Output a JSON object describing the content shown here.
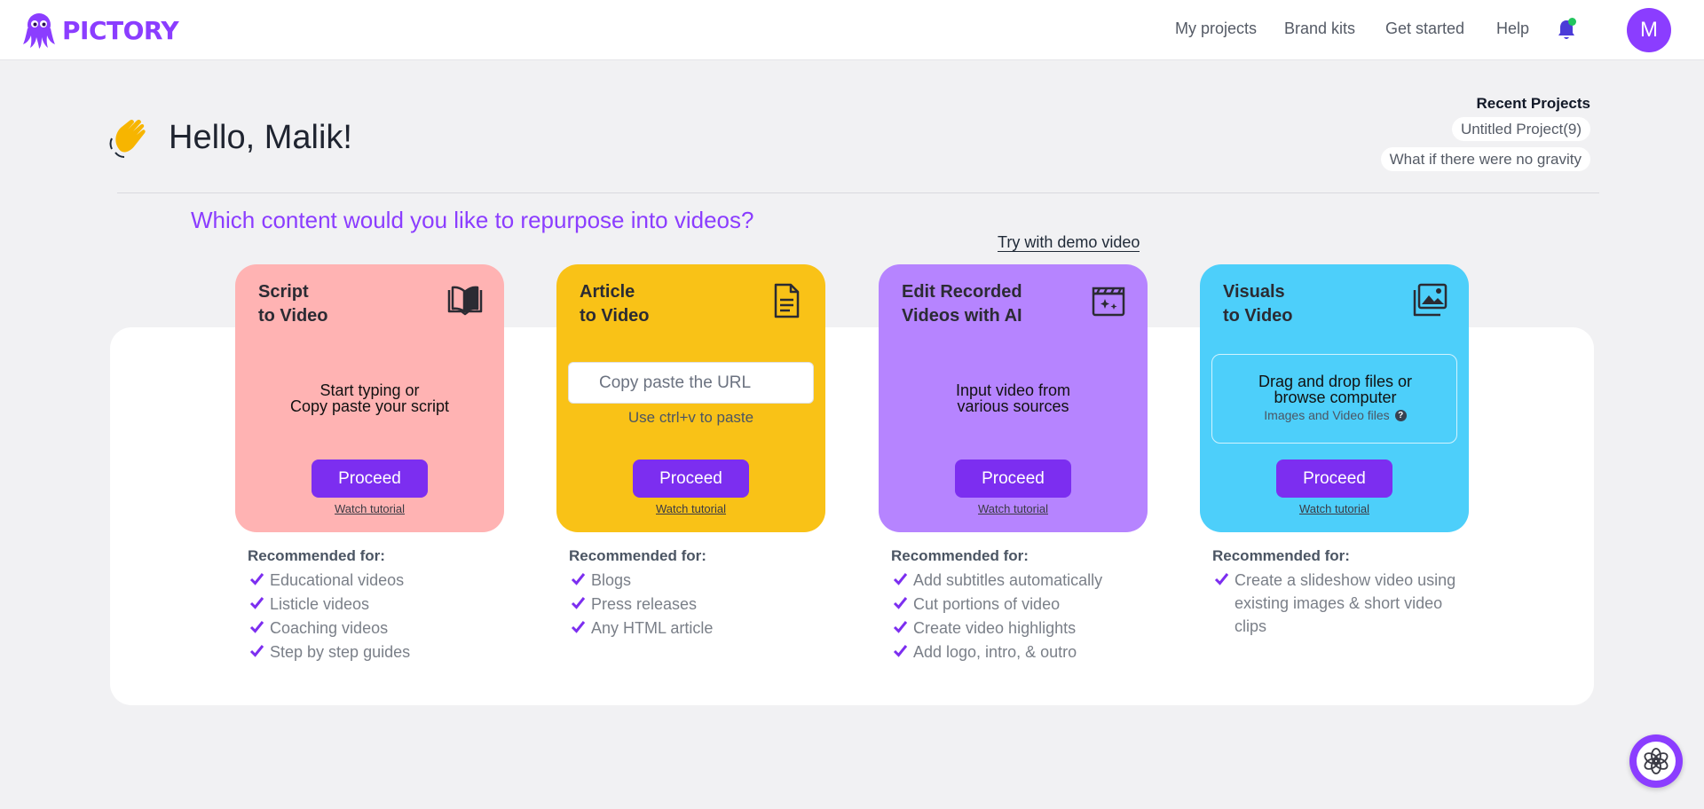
{
  "brand": {
    "name": "PICTORY",
    "color": "#8b3dff"
  },
  "nav": {
    "items": [
      "My projects",
      "Brand kits",
      "Get started",
      "Help"
    ],
    "notification_icon": "bell-icon",
    "avatar_initial": "M"
  },
  "greeting": {
    "emoji": "waving-hand",
    "text": "Hello, Malik!"
  },
  "recent": {
    "title": "Recent Projects",
    "items": [
      "Untitled Project(9)",
      "What if there were no gravity"
    ]
  },
  "question": "Which content would you like to repurpose into videos?",
  "demo_link": "Try with demo video",
  "cards": [
    {
      "title_line1": "Script",
      "title_line2": "to Video",
      "icon": "open-book-icon",
      "color": "#ffb3b3",
      "desc_line1": "Start typing or",
      "desc_line2": "Copy paste your script",
      "proceed": "Proceed",
      "watch": "Watch tutorial",
      "rec_title": "Recommended for:",
      "rec": [
        "Educational videos",
        "Listicle videos",
        "Coaching videos",
        "Step by step guides"
      ]
    },
    {
      "title_line1": "Article",
      "title_line2": "to Video",
      "icon": "document-icon",
      "color": "#f9c217",
      "url_placeholder": "Copy paste the URL",
      "url_hint": "Use ctrl+v to paste",
      "proceed": "Proceed",
      "watch": "Watch tutorial",
      "rec_title": "Recommended for:",
      "rec": [
        "Blogs",
        "Press releases",
        "Any HTML article"
      ]
    },
    {
      "title_line1": "Edit Recorded",
      "title_line2": "Videos with AI",
      "icon": "clapperboard-sparkle-icon",
      "color": "#b684ff",
      "desc_line1": "Input video from",
      "desc_line2": "various sources",
      "proceed": "Proceed",
      "watch": "Watch tutorial",
      "rec_title": "Recommended for:",
      "rec": [
        "Add subtitles automatically",
        "Cut portions of video",
        "Create video highlights",
        "Add logo, intro, & outro"
      ]
    },
    {
      "title_line1": "Visuals",
      "title_line2": "to Video",
      "icon": "image-gallery-icon",
      "color": "#4dcffa",
      "dz_line1": "Drag and drop files or",
      "dz_line2": "browse computer",
      "dz_sub": "Images and Video files",
      "proceed": "Proceed",
      "watch": "Watch tutorial",
      "rec_title": "Recommended for:",
      "rec": [
        "Create a slideshow video using existing images & short video clips"
      ]
    }
  ],
  "check_color": "#7c2ef0",
  "chat": {
    "icon": "chat-assistant-icon"
  }
}
